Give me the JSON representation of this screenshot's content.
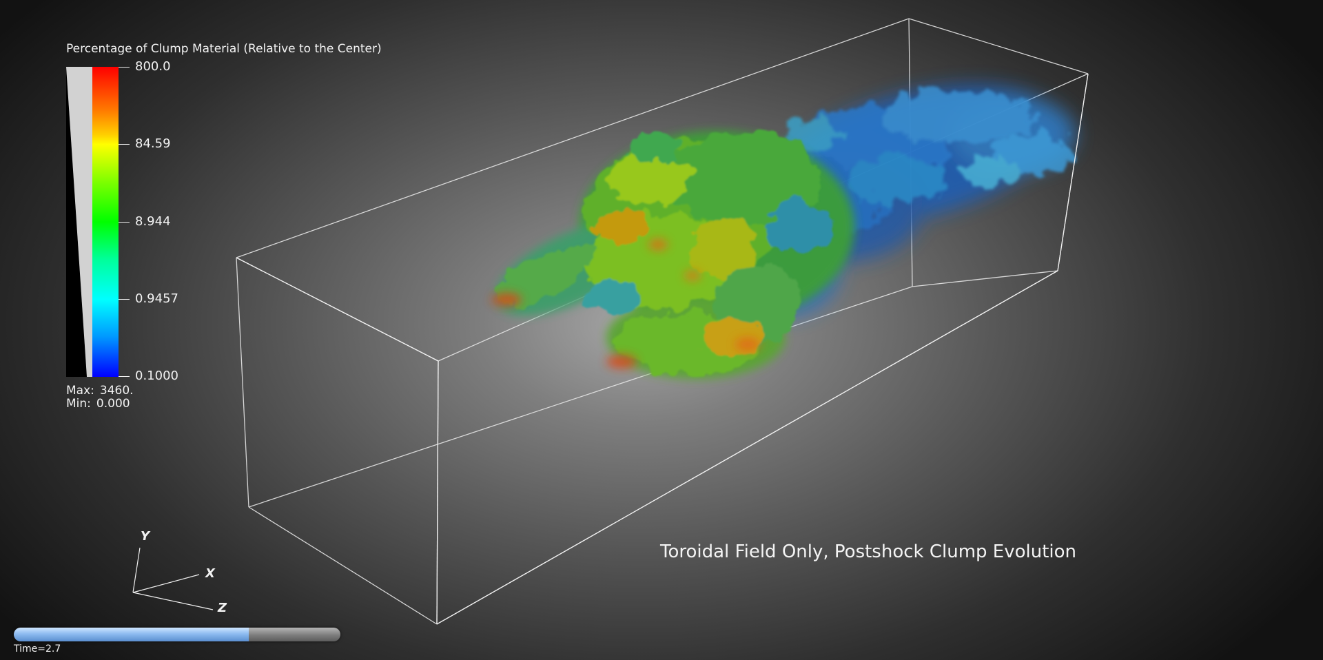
{
  "legend": {
    "title": "Percentage of Clump Material (Relative to the Center)",
    "ticks": [
      "800.0",
      "84.59",
      "8.944",
      "0.9457",
      "0.1000"
    ],
    "max_label": "Max:",
    "max_value": "3460.",
    "min_label": "Min:",
    "min_value": "0.000",
    "colormap": [
      "#ff0000",
      "#ff7a00",
      "#ffff00",
      "#00ff00",
      "#00ffff",
      "#0000ff"
    ]
  },
  "triad": {
    "y_label": "Y",
    "x_label": "X",
    "z_label": "Z"
  },
  "annotation": {
    "title": "Toroidal Field Only, Postshock Clump Evolution"
  },
  "time_slider": {
    "label": "Time=2.7",
    "progress": 0.72
  }
}
